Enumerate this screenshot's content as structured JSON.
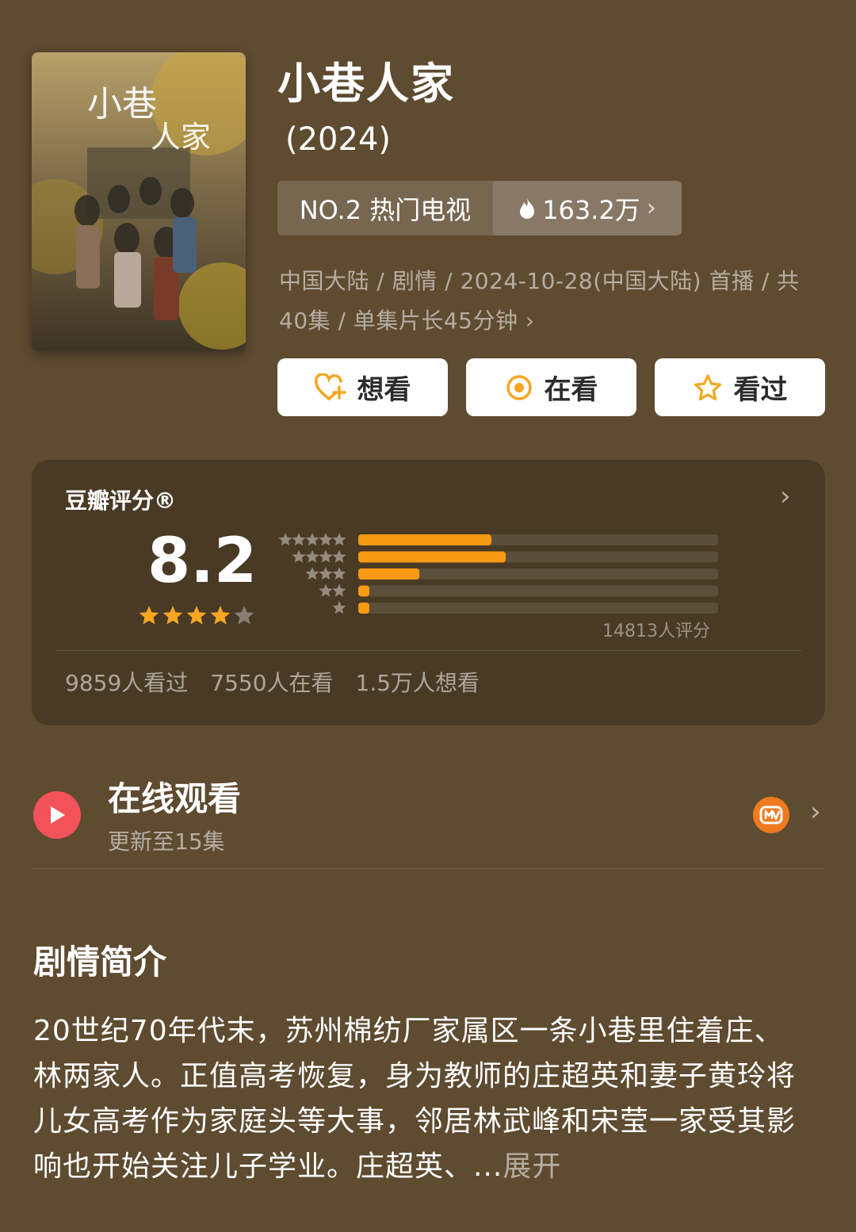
{
  "header": {
    "title": "小巷人家",
    "year": "(2024)"
  },
  "rank": {
    "label": "NO.2 热门电视",
    "heat": "163.2万"
  },
  "meta": {
    "line1": "中国大陆 / 剧情 / 2024-10-28(中国大陆) 首播 / 共",
    "line2": "40集 / 单集片长45分钟"
  },
  "actions": {
    "want": "想看",
    "watching": "在看",
    "watched": "看过"
  },
  "rating": {
    "label": "豆瓣评分®",
    "score": "8.2",
    "stars_filled": 4,
    "stars_total": 5,
    "distribution_fraction": [
      0.37,
      0.41,
      0.17,
      0.03,
      0.03
    ],
    "total": "14813人评分",
    "stats": {
      "watched": "9859人看过",
      "watching": "7550人在看",
      "want": "1.5万人想看"
    }
  },
  "online": {
    "title": "在线观看",
    "subtitle": "更新至15集",
    "platform_icon": "mango-tv-icon"
  },
  "synopsis": {
    "heading": "剧情简介",
    "text": "20世纪70年代末，苏州棉纺厂家属区一条小巷里住着庄、林两家人。正值高考恢复，身为教师的庄超英和妻子黄玲将儿女高考作为家庭头等大事，邻居林武峰和宋莹一家受其影响也开始关注儿子学业。庄超英、...",
    "expand": "展开"
  },
  "colors": {
    "background": "#5e4b30",
    "bar_fill": "#f59a12",
    "star": "#f5a623",
    "play": "#f2525a"
  }
}
